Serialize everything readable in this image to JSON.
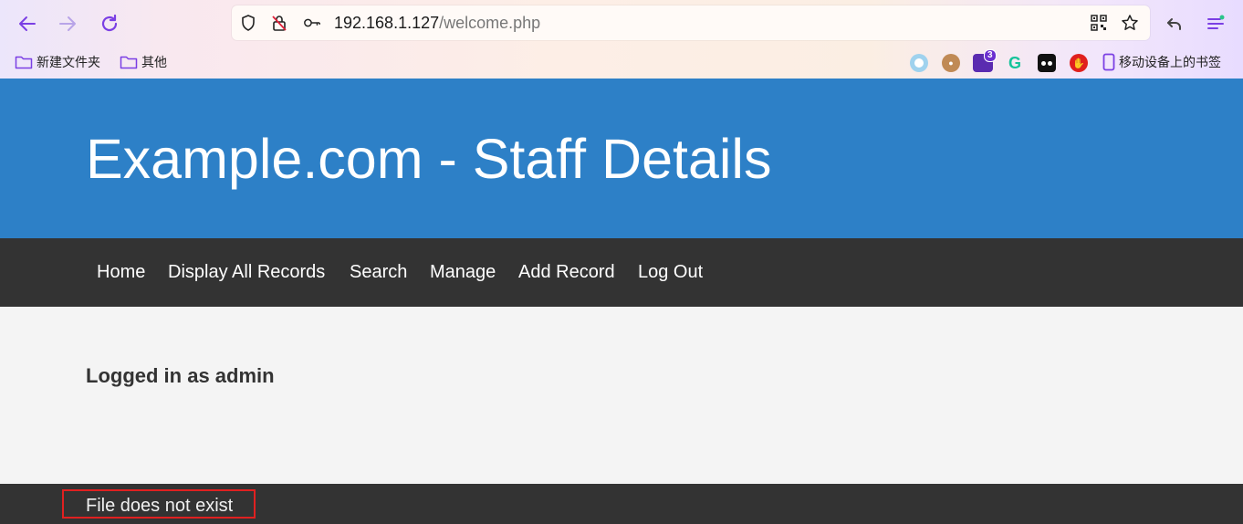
{
  "browser": {
    "url_host": "192.168.1.127",
    "url_path": "/welcome.php",
    "bookmarks": [
      {
        "label": "新建文件夹",
        "icon": "folder-icon"
      },
      {
        "label": "其他",
        "icon": "folder-icon"
      }
    ],
    "mobile_bookmarks_label": "移动设备上的书签",
    "extension_badge": "3",
    "accent_color": "#7b3fe4"
  },
  "site": {
    "title": "Example.com - Staff Details",
    "nav": [
      "Home",
      "Display All Records",
      "Search",
      "Manage",
      "Add Record",
      "Log Out"
    ],
    "logged_in_text": "Logged in as admin",
    "footer_text": "File does not exist",
    "header_color": "#2d80c7",
    "nav_color": "#333333"
  }
}
